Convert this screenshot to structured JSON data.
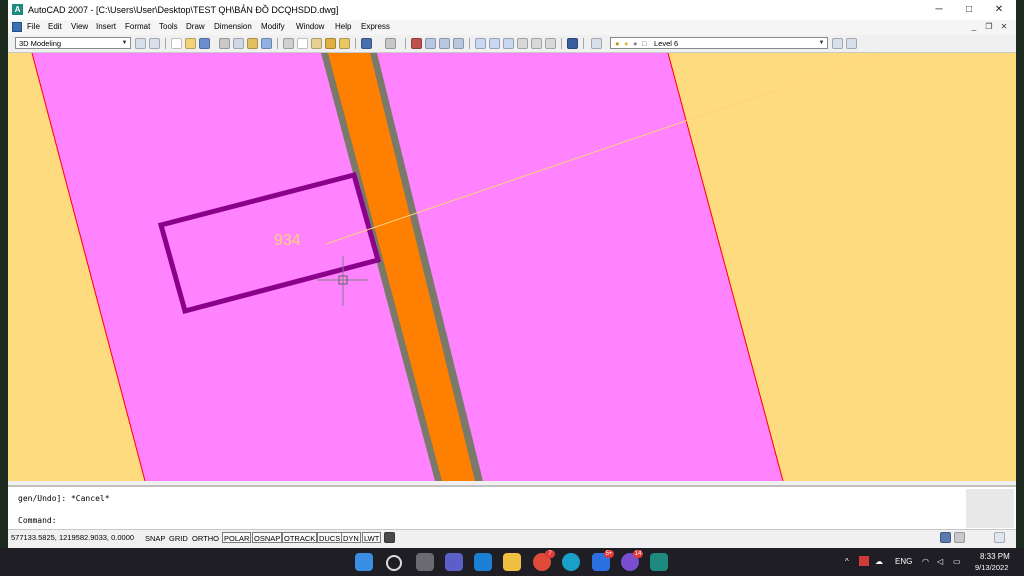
{
  "window": {
    "title": "AutoCAD 2007 - [C:\\Users\\User\\Desktop\\TEST QH\\BẢN ĐỒ DCQHSDD.dwg]",
    "app_icon": "autocad-icon",
    "minimize_glyph": "─",
    "maximize_glyph": "□",
    "close_glyph": "✕",
    "doc_minimize_glyph": "_",
    "doc_restore_glyph": "❐",
    "doc_close_glyph": "✕"
  },
  "menu": [
    "File",
    "Edit",
    "View",
    "Insert",
    "Format",
    "Tools",
    "Draw",
    "Dimension",
    "Modify",
    "Window",
    "Help",
    "Express"
  ],
  "toolbar": {
    "workspace": "3D Modeling",
    "layer": "Level 6",
    "combo_arrow": "▼"
  },
  "drawing": {
    "parcel_label": "934",
    "colors": {
      "background": "#ffdb7f",
      "parcel_fill": "#ff82ff",
      "road": "#ff7f00",
      "road_edge": "#7a7a6a",
      "building": "#8a008a",
      "boundary": "#ff0000",
      "label": "#ffd27a"
    }
  },
  "command": {
    "history_line": "gen/Undo]: *Cancel*",
    "prompt": "Command:"
  },
  "status": {
    "coords": "577133.5825, 1219582.9033, 0.0000",
    "buttons": [
      {
        "label": "SNAP",
        "on": false
      },
      {
        "label": "GRID",
        "on": false
      },
      {
        "label": "ORTHO",
        "on": false
      },
      {
        "label": "POLAR",
        "on": true
      },
      {
        "label": "OSNAP",
        "on": true
      },
      {
        "label": "OTRACK",
        "on": true
      },
      {
        "label": "DUCS",
        "on": true
      },
      {
        "label": "DYN",
        "on": true
      },
      {
        "label": "LWT",
        "on": true
      }
    ]
  },
  "taskbar": {
    "apps": [
      {
        "name": "start-icon",
        "badge": ""
      },
      {
        "name": "search-icon",
        "badge": ""
      },
      {
        "name": "task-view-icon",
        "badge": ""
      },
      {
        "name": "chat-icon",
        "badge": ""
      },
      {
        "name": "mail-icon",
        "badge": ""
      },
      {
        "name": "file-explorer-icon",
        "badge": ""
      },
      {
        "name": "chrome-icon",
        "badge": "7"
      },
      {
        "name": "edge-icon",
        "badge": ""
      },
      {
        "name": "zalo-icon",
        "badge": "5+"
      },
      {
        "name": "viber-icon",
        "badge": "14"
      },
      {
        "name": "autocad-icon",
        "badge": ""
      }
    ],
    "language": "ENG",
    "time": "8:33 PM",
    "date": "9/13/2022"
  }
}
